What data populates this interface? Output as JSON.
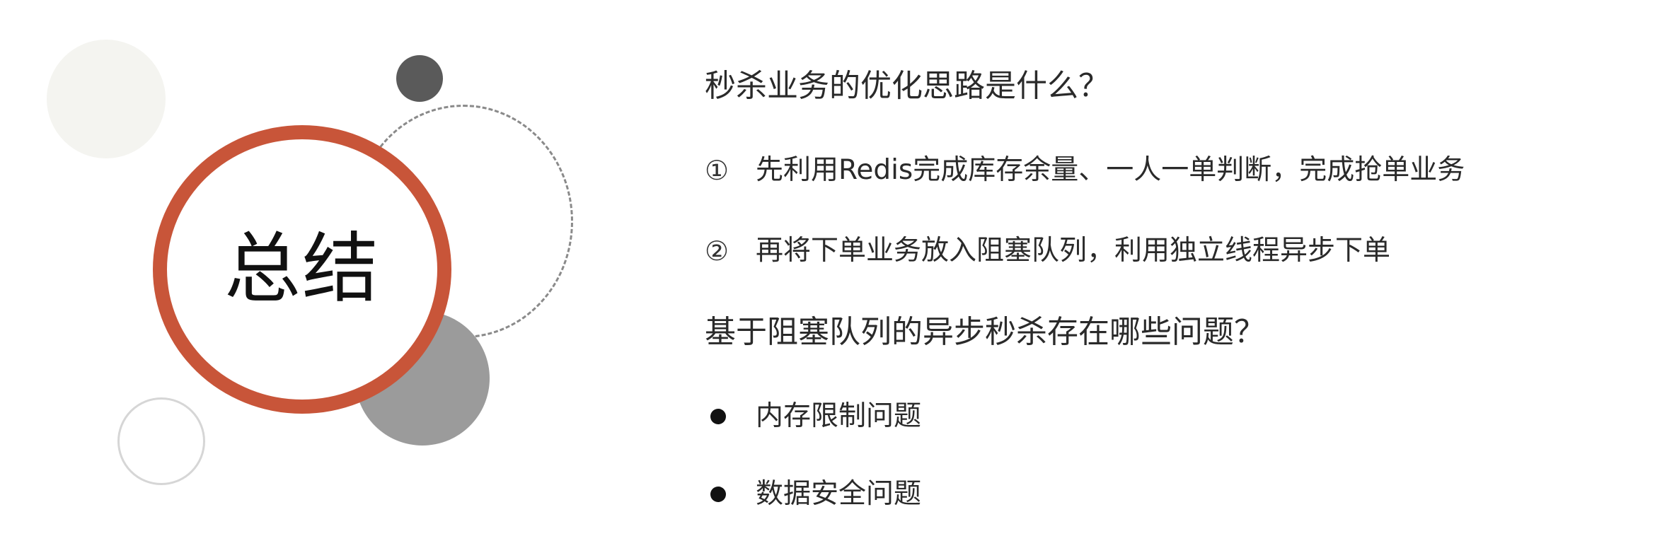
{
  "title": "总结",
  "questions": [
    {
      "text": "秒杀业务的优化思路是什么？",
      "items": [
        {
          "marker": "①",
          "text": "先利用Redis完成库存余量、一人一单判断，完成抢单业务"
        },
        {
          "marker": "②",
          "text": "再将下单业务放入阻塞队列，利用独立线程异步下单"
        }
      ]
    },
    {
      "text": "基于阻塞队列的异步秒杀存在哪些问题？",
      "items": [
        {
          "text": "内存限制问题"
        },
        {
          "text": "数据安全问题"
        }
      ]
    }
  ],
  "colors": {
    "ring": "#c85539",
    "dark_dot": "#5a5a5a",
    "gray_circle": "#9b9b9b",
    "pale_circle": "#f4f4f0"
  }
}
